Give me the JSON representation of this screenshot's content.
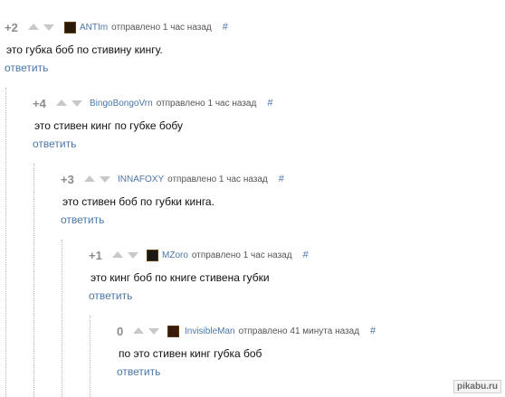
{
  "comments": [
    {
      "rating": "+2",
      "author": "ANTIm",
      "meta": "отправлено 1 час назад",
      "hash": "#",
      "text": "это губка боб по стивину кингу.",
      "reply": "ответить",
      "avatar_color": "#2b1a08"
    },
    {
      "rating": "+4",
      "author": "BingoBongoVrn",
      "meta": "отправлено 1 час назад",
      "hash": "#",
      "text": "это стивен кинг по губке бобу",
      "reply": "ответить"
    },
    {
      "rating": "+3",
      "author": "INNAFOXY",
      "meta": "отправлено 1 час назад",
      "hash": "#",
      "text": "это стивен боб по губки кинга.",
      "reply": "ответить"
    },
    {
      "rating": "+1",
      "author": "MZoro",
      "meta": "отправлено 1 час назад",
      "hash": "#",
      "text": "это кинг боб по книге стивена губки",
      "reply": "ответить",
      "avatar_color": "#1a1a10"
    },
    {
      "rating": "0",
      "author": "InvisibleMan",
      "meta": "отправлено 41 минута назад",
      "hash": "#",
      "text": "по это стивен кинг губка боб",
      "reply": "ответить",
      "avatar_color": "#3a1a0a"
    }
  ],
  "watermark": "pikabu.ru",
  "colors": {
    "link": "#4a76a8",
    "rating": "#8c8c8c",
    "vote_arrow": "#c8c8c8"
  }
}
